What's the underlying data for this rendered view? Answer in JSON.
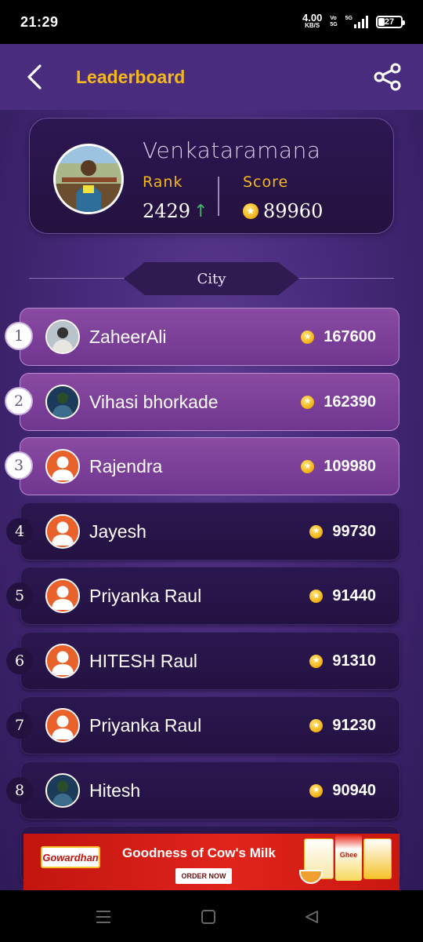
{
  "status_bar": {
    "time": "21:29",
    "net_speed_value": "4.00",
    "net_speed_unit": "KB/S",
    "volte_top": "Vo",
    "volte_bottom": "5G",
    "network_type": "5G",
    "battery": "27"
  },
  "header": {
    "title": "Leaderboard",
    "back_icon": "chevron-left-icon",
    "share_icon": "share-icon",
    "title_color": "#f4b81c"
  },
  "profile": {
    "name": "Venkataramana",
    "rank_label": "Rank",
    "rank_value": "2429",
    "rank_trend": "↑",
    "score_label": "Score",
    "score_value": "89960"
  },
  "filter": {
    "selected": "City"
  },
  "leaderboard": [
    {
      "rank": "1",
      "name": "ZaheerAli",
      "score": "167600",
      "avatar": "photo"
    },
    {
      "rank": "2",
      "name": "Vihasi bhorkade",
      "score": "162390",
      "avatar": "photo"
    },
    {
      "rank": "3",
      "name": "Rajendra",
      "score": "109980",
      "avatar": "default"
    },
    {
      "rank": "4",
      "name": "Jayesh",
      "score": "99730",
      "avatar": "default"
    },
    {
      "rank": "5",
      "name": "Priyanka Raul",
      "score": "91440",
      "avatar": "default"
    },
    {
      "rank": "6",
      "name": "HITESH Raul",
      "score": "91310",
      "avatar": "default"
    },
    {
      "rank": "7",
      "name": "Priyanka Raul",
      "score": "91230",
      "avatar": "default"
    },
    {
      "rank": "8",
      "name": "Hitesh",
      "score": "90940",
      "avatar": "photo"
    }
  ],
  "ad": {
    "brand": "Gowardhan",
    "headline": "Goodness of Cow's Milk",
    "cta": "ORDER NOW",
    "product_label": "Ghee"
  },
  "colors": {
    "accent": "#f4b81c",
    "background": "#46297a",
    "top_row": "#7b3f98",
    "other_row": "#271446",
    "trend_up": "#47b36a"
  }
}
